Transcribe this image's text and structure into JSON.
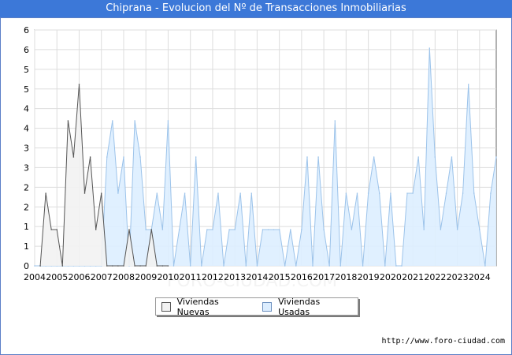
{
  "title": "Chiprana - Evolucion del Nº de Transacciones Inmobiliarias",
  "source": "http://www.foro-ciudad.com",
  "watermark": "FORO-CIUDAD.COM",
  "colors": {
    "title_bg": "#3c78d8",
    "nuevas_fill": "#f2f2f2",
    "nuevas_line": "#555555",
    "usadas_fill": "#ddeeff",
    "usadas_line": "#9cc3ea",
    "grid": "#dddddd"
  },
  "chart_data": {
    "type": "area",
    "title": "Chiprana - Evolucion del Nº de Transacciones Inmobiliarias",
    "x_ticks": [
      "2004",
      "2005",
      "2006",
      "2007",
      "2008",
      "2009",
      "2010",
      "2011",
      "2012",
      "2013",
      "2014",
      "2015",
      "2016",
      "2017",
      "2018",
      "2019",
      "2020",
      "2021",
      "2022",
      "2023",
      "2024"
    ],
    "y_tick_labels": [
      "0",
      "1",
      "1",
      "2",
      "2",
      "3",
      "3",
      "4",
      "4",
      "5",
      "5",
      "6",
      "6"
    ],
    "ylim": [
      0,
      6.5
    ],
    "xlim": [
      2004,
      2024.75
    ],
    "grid": true,
    "legend_position": "bottom-center",
    "series": [
      {
        "name": "Viviendas Nuevas",
        "x": [
          2004.25,
          2004.5,
          2004.75,
          2005.0,
          2005.25,
          2005.5,
          2005.75,
          2006.0,
          2006.25,
          2006.5,
          2006.75,
          2007.0,
          2007.25,
          2007.5,
          2007.75,
          2008.0,
          2008.25,
          2008.5,
          2008.75,
          2009.0,
          2009.25,
          2009.5,
          2009.75,
          2010.0
        ],
        "values": [
          0,
          2,
          1,
          1,
          0,
          4,
          3,
          5,
          2,
          3,
          1,
          2,
          0,
          0,
          0,
          0,
          1,
          0,
          0,
          0,
          1,
          0,
          0,
          0
        ]
      },
      {
        "name": "Viviendas Usadas",
        "x": [
          2004.0,
          2004.25,
          2004.5,
          2004.75,
          2005.0,
          2005.25,
          2005.5,
          2005.75,
          2006.0,
          2006.25,
          2006.5,
          2006.75,
          2007.0,
          2007.25,
          2007.5,
          2007.75,
          2008.0,
          2008.25,
          2008.5,
          2008.75,
          2009.0,
          2009.25,
          2009.5,
          2009.75,
          2010.0,
          2010.25,
          2010.5,
          2010.75,
          2011.0,
          2011.25,
          2011.5,
          2011.75,
          2012.0,
          2012.25,
          2012.5,
          2012.75,
          2013.0,
          2013.25,
          2013.5,
          2013.75,
          2014.0,
          2014.25,
          2014.5,
          2014.75,
          2015.0,
          2015.25,
          2015.5,
          2015.75,
          2016.0,
          2016.25,
          2016.5,
          2016.75,
          2017.0,
          2017.25,
          2017.5,
          2017.75,
          2018.0,
          2018.25,
          2018.5,
          2018.75,
          2019.0,
          2019.25,
          2019.5,
          2019.75,
          2020.0,
          2020.25,
          2020.5,
          2020.75,
          2021.0,
          2021.25,
          2021.5,
          2021.75,
          2022.0,
          2022.25,
          2022.5,
          2022.75,
          2023.0,
          2023.25,
          2023.5,
          2023.75,
          2024.0,
          2024.25,
          2024.5,
          2024.75
        ],
        "values": [
          0,
          0,
          0,
          0,
          0,
          0,
          0,
          0,
          0,
          0,
          0,
          0,
          0,
          3,
          4,
          2,
          3,
          0,
          4,
          3,
          1,
          1,
          2,
          1,
          4,
          0,
          1,
          2,
          0,
          3,
          0,
          1,
          1,
          2,
          0,
          1,
          1,
          2,
          0,
          2,
          0,
          1,
          1,
          1,
          1,
          0,
          1,
          0,
          1,
          3,
          0,
          3,
          1,
          0,
          4,
          0,
          2,
          1,
          2,
          0,
          2,
          3,
          2,
          0,
          2,
          0,
          0,
          2,
          2,
          3,
          1,
          6,
          3,
          1,
          2,
          3,
          1,
          2,
          5,
          2,
          1,
          0,
          2,
          3
        ]
      }
    ]
  }
}
